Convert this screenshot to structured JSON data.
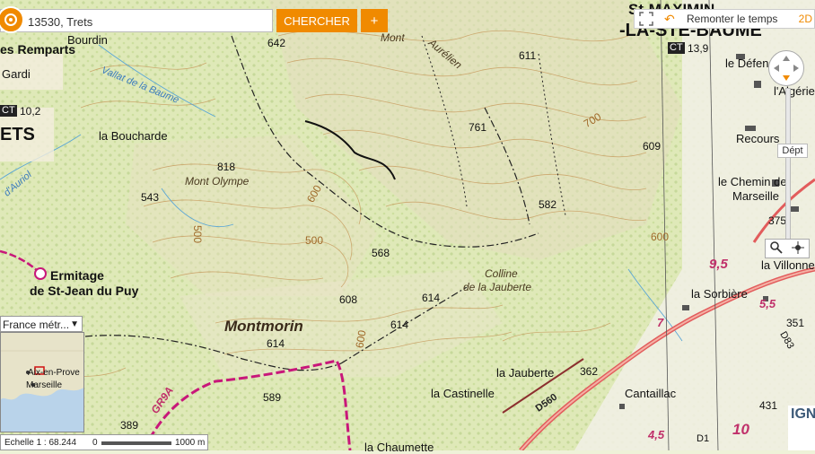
{
  "search": {
    "value": "13530, Trets",
    "button": "CHERCHER",
    "plus": "+"
  },
  "timebar": {
    "label": "Remonter le temps",
    "mode": "2D"
  },
  "nav": {
    "dept_label": "Dépt"
  },
  "overview": {
    "layer": "France métr...",
    "city": "Aix-en-Prove",
    "city2": "Marseille"
  },
  "scale": {
    "label": "Echelle 1 : 68.244",
    "zero": "0",
    "max": "1000 m"
  },
  "logo": "IGN",
  "map": {
    "places": {
      "remparts": "es Remparts",
      "bourdin": "Bourdin",
      "gardi": "Gardi",
      "boucharde": "la Boucharde",
      "ets": "ETS",
      "ermitage1": "Ermitage",
      "ermitage2": "de St-Jean du Puy",
      "ste_baume1": "St-MAXIMIN",
      "ste_baume2": "-LA-STE-BAUME",
      "defens": "le Défens",
      "algerie": "l'Algérie",
      "recours": "Recours",
      "chemin1": "le Chemin de",
      "chemin2": "Marseille",
      "villonne": "la Villonne",
      "sorbiere": "la Sorbière",
      "jauberte": "la Jauberte",
      "castinelle": "la Castinelle",
      "cantaillac": "Cantaillac",
      "chaumette": "la Chaumette"
    },
    "natural": {
      "mont_aurelien1": "Mont",
      "mont_aurelien2": "Aurélien",
      "mont_olympe": "Mont Olympe",
      "montmorin": "Montmorin",
      "colline1": "Colline",
      "colline2": "de la Jauberte",
      "vallat": "Vallat de la Baume",
      "auriol": "d'Auriol"
    },
    "altitudes": [
      "642",
      "611",
      "761",
      "609",
      "818",
      "543",
      "582",
      "568",
      "608",
      "614",
      "614",
      "614",
      "589",
      "389",
      "351",
      "431",
      "362",
      "700",
      "600",
      "500",
      "600",
      "500",
      "600",
      "13,9",
      "10,2",
      "375"
    ],
    "roads": {
      "ct1": "CT",
      "ct2": "CT",
      "d560": "D560",
      "d1": "D1",
      "d83": "D83",
      "gr9a": "GR9A",
      "k95": "9,5",
      "k55": "5,5",
      "k7": "7",
      "k45": "4,5",
      "k10": "10"
    }
  }
}
